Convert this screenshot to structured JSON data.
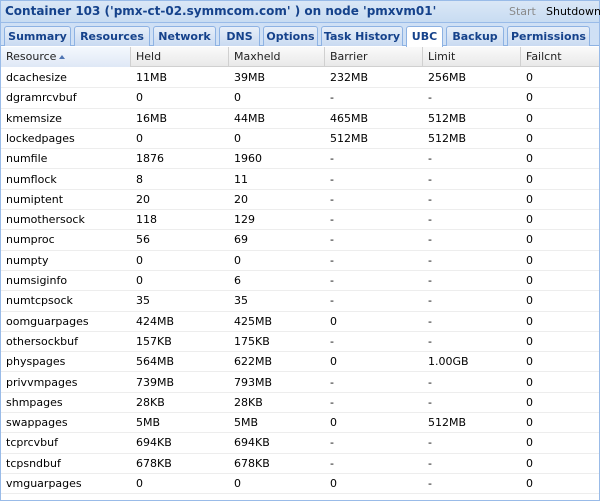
{
  "window": {
    "title": "Container 103 ('pmx-ct-02.symmcom.com' ) on node 'pmxvm01'",
    "start_label": "Start",
    "shutdown_label": "Shutdown"
  },
  "tabs": [
    {
      "label": "Summary"
    },
    {
      "label": "Resources"
    },
    {
      "label": "Network"
    },
    {
      "label": "DNS"
    },
    {
      "label": "Options"
    },
    {
      "label": "Task History"
    },
    {
      "label": "UBC",
      "active": true
    },
    {
      "label": "Backup"
    },
    {
      "label": "Permissions"
    }
  ],
  "table": {
    "columns": [
      "Resource",
      "Held",
      "Maxheld",
      "Barrier",
      "Limit",
      "Failcnt"
    ],
    "sorted_column": 0,
    "rows": [
      [
        "dcachesize",
        "11MB",
        "39MB",
        "232MB",
        "256MB",
        "0"
      ],
      [
        "dgramrcvbuf",
        "0",
        "0",
        "-",
        "-",
        "0"
      ],
      [
        "kmemsize",
        "16MB",
        "44MB",
        "465MB",
        "512MB",
        "0"
      ],
      [
        "lockedpages",
        "0",
        "0",
        "512MB",
        "512MB",
        "0"
      ],
      [
        "numfile",
        "1876",
        "1960",
        "-",
        "-",
        "0"
      ],
      [
        "numflock",
        "8",
        "11",
        "-",
        "-",
        "0"
      ],
      [
        "numiptent",
        "20",
        "20",
        "-",
        "-",
        "0"
      ],
      [
        "numothersock",
        "118",
        "129",
        "-",
        "-",
        "0"
      ],
      [
        "numproc",
        "56",
        "69",
        "-",
        "-",
        "0"
      ],
      [
        "numpty",
        "0",
        "0",
        "-",
        "-",
        "0"
      ],
      [
        "numsiginfo",
        "0",
        "6",
        "-",
        "-",
        "0"
      ],
      [
        "numtcpsock",
        "35",
        "35",
        "-",
        "-",
        "0"
      ],
      [
        "oomguarpages",
        "424MB",
        "425MB",
        "0",
        "-",
        "0"
      ],
      [
        "othersockbuf",
        "157KB",
        "175KB",
        "-",
        "-",
        "0"
      ],
      [
        "physpages",
        "564MB",
        "622MB",
        "0",
        "1.00GB",
        "0"
      ],
      [
        "privvmpages",
        "739MB",
        "793MB",
        "-",
        "-",
        "0"
      ],
      [
        "shmpages",
        "28KB",
        "28KB",
        "-",
        "-",
        "0"
      ],
      [
        "swappages",
        "5MB",
        "5MB",
        "0",
        "512MB",
        "0"
      ],
      [
        "tcprcvbuf",
        "694KB",
        "694KB",
        "-",
        "-",
        "0"
      ],
      [
        "tcpsndbuf",
        "678KB",
        "678KB",
        "-",
        "-",
        "0"
      ],
      [
        "vmguarpages",
        "0",
        "0",
        "0",
        "-",
        "0"
      ]
    ]
  }
}
